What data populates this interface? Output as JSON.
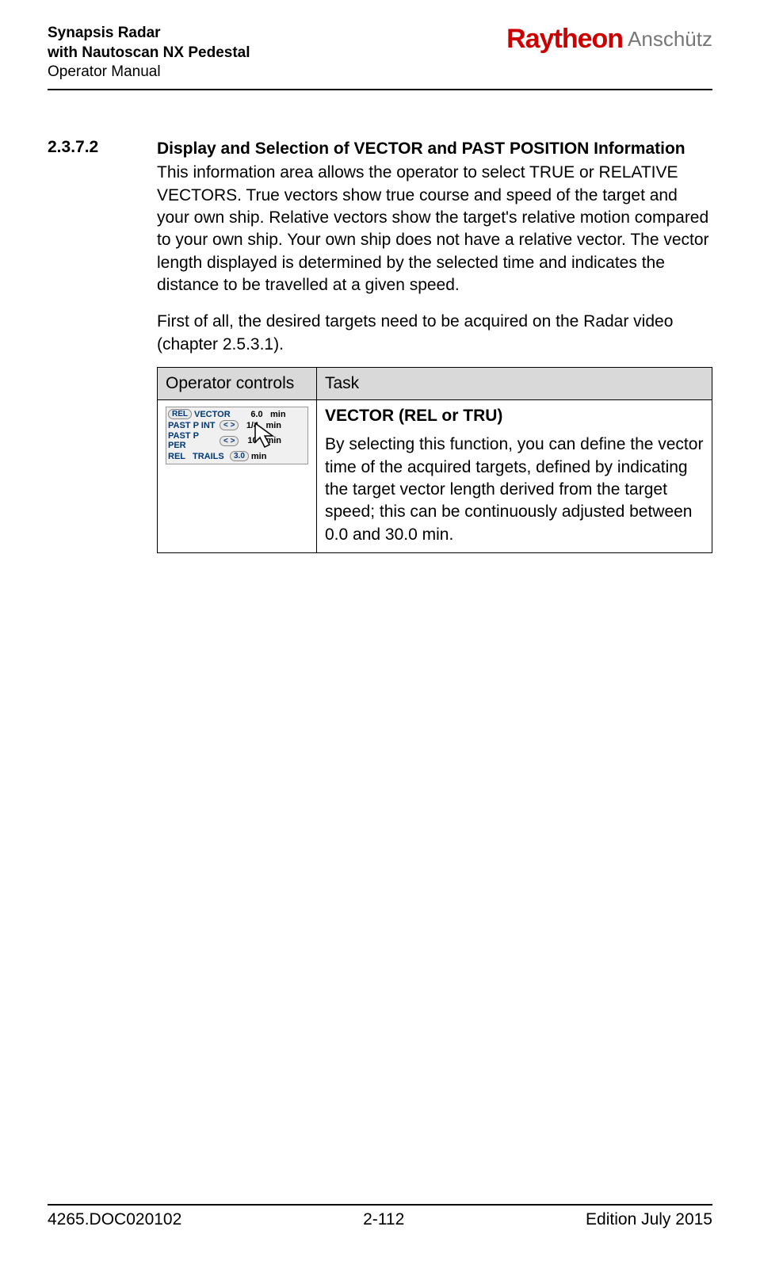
{
  "header": {
    "product_line1": "Synapsis Radar",
    "product_line2": "with Nautoscan NX Pedestal",
    "doc_type": "Operator Manual",
    "brand_primary": "Raytheon",
    "brand_secondary": "Anschütz"
  },
  "section": {
    "number": "2.3.7.2",
    "title": "Display and Selection of VECTOR and PAST POSITION Information",
    "para1": "This information area allows the operator to select TRUE or RELATIVE VECTORS. True vectors show true course and speed of the target and your own ship. Relative vectors show the target's relative motion compared to your own ship. Your own ship does not have a relative vector. The vector length displayed is determined by the selected time and indicates the distance to be travelled at a given speed.",
    "para2": "First of all, the desired targets need to be acquired on the Radar video (chapter 2.5.3.1)."
  },
  "table": {
    "header_col1": "Operator controls",
    "header_col2": "Task",
    "row1": {
      "task_title": "VECTOR (REL or TRU)",
      "task_body": "By selecting this function, you can define the vector time of the acquired targets, defined by indicating the target vector length derived from the target speed; this can be continuously adjusted between 0.0 and 30.0 min."
    }
  },
  "control_panel": {
    "row1": {
      "btn": "REL",
      "label": "VECTOR",
      "value": "6.0",
      "unit": "min"
    },
    "row2": {
      "label": "PAST P INT",
      "arrows": "< >",
      "value": "1/4",
      "unit": "min"
    },
    "row3": {
      "label": "PAST P PER",
      "arrows": "< >",
      "value": "10",
      "unit": "min"
    },
    "row4": {
      "mode": "REL",
      "label": "TRAILS",
      "value": "3.0",
      "unit": "min"
    }
  },
  "footer": {
    "doc_id": "4265.DOC020102",
    "page": "2-112",
    "edition": "Edition July 2015"
  }
}
